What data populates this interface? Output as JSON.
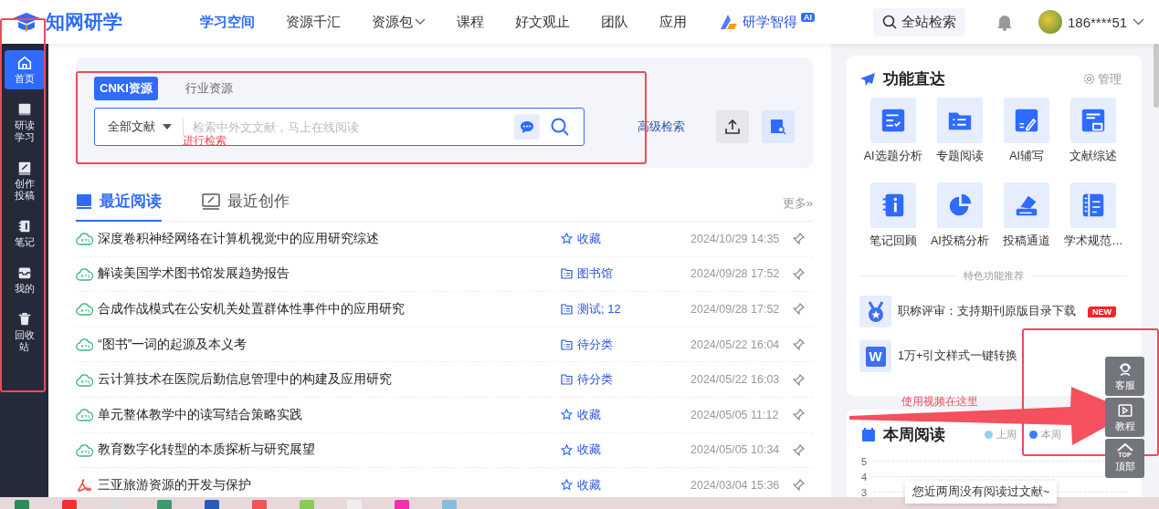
{
  "header": {
    "logo": "知网研学",
    "nav": [
      {
        "label": "学习空间",
        "selected": true,
        "dropdown": false
      },
      {
        "label": "资源千汇",
        "selected": false,
        "dropdown": false
      },
      {
        "label": "资源包",
        "selected": false,
        "dropdown": true
      },
      {
        "label": "课程",
        "selected": false,
        "dropdown": false
      },
      {
        "label": "好文观止",
        "selected": false,
        "dropdown": false
      },
      {
        "label": "团队",
        "selected": false,
        "dropdown": false
      },
      {
        "label": "应用",
        "selected": false,
        "dropdown": false
      }
    ],
    "ai_link": {
      "label": "研学智得",
      "badge": "AI"
    },
    "search_button": "全站检索",
    "user": "186****51"
  },
  "sidebar": {
    "items": [
      {
        "label": "首页",
        "kind": "home",
        "selected": true
      },
      {
        "label": "研读学习",
        "kind": "book",
        "selected": false
      },
      {
        "label": "创作投稿",
        "kind": "edit",
        "selected": false
      },
      {
        "label": "笔记",
        "kind": "note",
        "selected": false
      },
      {
        "label": "我的",
        "kind": "inbox",
        "selected": false
      },
      {
        "label": "回收站",
        "kind": "trash",
        "selected": false
      }
    ]
  },
  "search": {
    "tabs": [
      {
        "label": "CNKI资源",
        "selected": true
      },
      {
        "label": "行业资源",
        "selected": false
      }
    ],
    "scope": "全部文献",
    "placeholder": "检索中外文文献，马上在线阅读",
    "advanced": "高级检索"
  },
  "reading": {
    "tabs": [
      {
        "label": "最近阅读",
        "selected": true
      },
      {
        "label": "最近创作",
        "selected": false
      }
    ],
    "more": "更多»",
    "rows": [
      {
        "kind": "xml",
        "title": "深度卷积神经网络在计算机视觉中的应用研究综述",
        "folder": {
          "kind": "star",
          "label": "收藏"
        },
        "date": "2024/10/29 14:35"
      },
      {
        "kind": "xml",
        "title": "解读美国学术图书馆发展趋势报告",
        "folder": {
          "kind": "folder",
          "label": "图书馆"
        },
        "date": "2024/09/28 17:52"
      },
      {
        "kind": "xml",
        "title": "合成作战模式在公安机关处置群体性事件中的应用研究",
        "folder": {
          "kind": "folder",
          "label": "测试; 12"
        },
        "date": "2024/09/28 17:52"
      },
      {
        "kind": "xml",
        "title": "“图书”一词的起源及本义考",
        "folder": {
          "kind": "folder",
          "label": "待分类"
        },
        "date": "2024/05/22 16:04"
      },
      {
        "kind": "xml",
        "title": "云计算技术在医院后勤信息管理中的构建及应用研究",
        "folder": {
          "kind": "folder",
          "label": "待分类"
        },
        "date": "2024/05/22 16:03"
      },
      {
        "kind": "xml",
        "title": "单元整体教学中的读写结合策略实践",
        "folder": {
          "kind": "star",
          "label": "收藏"
        },
        "date": "2024/05/05 11:12"
      },
      {
        "kind": "xml",
        "title": "教育数字化转型的本质探析与研究展望",
        "folder": {
          "kind": "star",
          "label": "收藏"
        },
        "date": "2024/05/05 10:34"
      },
      {
        "kind": "pdf",
        "title": "三亚旅游资源的开发与保护",
        "folder": {
          "kind": "star",
          "label": "收藏"
        },
        "date": "2024/03/04 15:36"
      }
    ]
  },
  "functions": {
    "title": "功能直达",
    "manage": "管理",
    "tiles": [
      {
        "label": "AI选题分析",
        "kind": "checklist"
      },
      {
        "label": "专题阅读",
        "kind": "folder"
      },
      {
        "label": "AI辅写",
        "kind": "pen"
      },
      {
        "label": "文献综述",
        "kind": "doc"
      },
      {
        "label": "笔记回顾",
        "kind": "notebook"
      },
      {
        "label": "AI投稿分析",
        "kind": "pie"
      },
      {
        "label": "投稿通道",
        "kind": "sign"
      },
      {
        "label": "学术规范…",
        "kind": "ruler"
      }
    ],
    "featured_title": "特色功能推荐",
    "featured": [
      {
        "kind": "medal",
        "label": "职称评审：支持期刊原版目录下载",
        "badge": "NEW"
      },
      {
        "kind": "letter",
        "letter": "W",
        "label": "1万+引文样式一键转换"
      }
    ]
  },
  "weekly": {
    "title": "本周阅读",
    "legend": [
      {
        "label": "上周",
        "color": "#8fd3f5"
      },
      {
        "label": "本周",
        "color": "#3d7bff"
      }
    ],
    "yticks": [
      "5",
      "4",
      "3"
    ],
    "tooltip": "您近两周没有阅读过文献~"
  },
  "float_buttons": [
    {
      "label": "客服",
      "kind": "service"
    },
    {
      "label": "教程",
      "kind": "video"
    },
    {
      "label": "顶部",
      "kind": "top",
      "icon_text": "TOP"
    }
  ],
  "annotations": {
    "search_note": "进行检索",
    "video_note": "使用视频在这里"
  }
}
